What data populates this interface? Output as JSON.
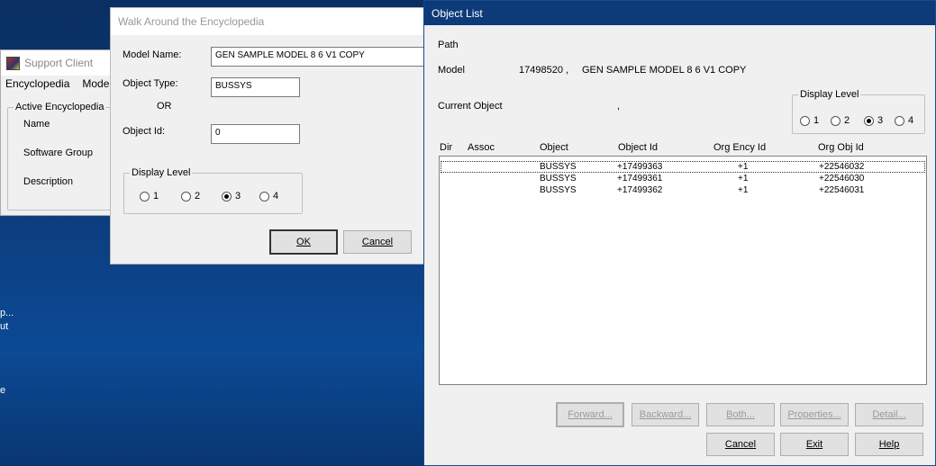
{
  "desktop": {
    "texts": [
      "p...",
      "ut",
      "e"
    ]
  },
  "support_client": {
    "title": "Support Client",
    "menu": [
      "Encyclopedia",
      "Model"
    ],
    "group_title": "Active Encyclopedia",
    "labels": [
      "Name",
      "Software Group",
      "Description"
    ]
  },
  "walk": {
    "title": "Walk Around the Encyclopedia",
    "model_name_label": "Model Name:",
    "model_name_value": "GEN SAMPLE MODEL 8 6 V1 COPY",
    "object_type_label": "Object Type:",
    "object_type_value": "BUSSYS",
    "or_label": "OR",
    "object_id_label": "Object Id:",
    "object_id_value": "0",
    "display_level": {
      "title": "Display Level",
      "options": [
        "1",
        "2",
        "3",
        "4"
      ],
      "selected": "3"
    },
    "ok_label": "OK",
    "cancel_label": "Cancel"
  },
  "objlist": {
    "title": "Object List",
    "path_label": "Path",
    "model_label": "Model",
    "model_id": "17498520 ,",
    "model_name": "GEN SAMPLE MODEL 8 6 V1 COPY",
    "current_object_label": "Current Object",
    "current_object_value": ",",
    "display_level": {
      "title": "Display Level",
      "options": [
        "1",
        "2",
        "3",
        "4"
      ],
      "selected": "3"
    },
    "columns": [
      "Dir",
      "Assoc",
      "Object",
      "Object Id",
      "Org Ency Id",
      "Org Obj Id"
    ],
    "rows": [
      {
        "dir": "",
        "assoc": "",
        "object": "BUSSYS",
        "object_id": "+17499363",
        "org_ency_id": "+1",
        "org_obj_id": "+22546032"
      },
      {
        "dir": "",
        "assoc": "",
        "object": "BUSSYS",
        "object_id": "+17499361",
        "org_ency_id": "+1",
        "org_obj_id": "+22546030"
      },
      {
        "dir": "",
        "assoc": "",
        "object": "BUSSYS",
        "object_id": "+17499362",
        "org_ency_id": "+1",
        "org_obj_id": "+22546031"
      }
    ],
    "buttons": {
      "forward": "Forward...",
      "backward": "Backward...",
      "both": "Both...",
      "properties": "Properties...",
      "detail": "Detail...",
      "cancel": "Cancel",
      "exit": "Exit",
      "help": "Help"
    }
  }
}
